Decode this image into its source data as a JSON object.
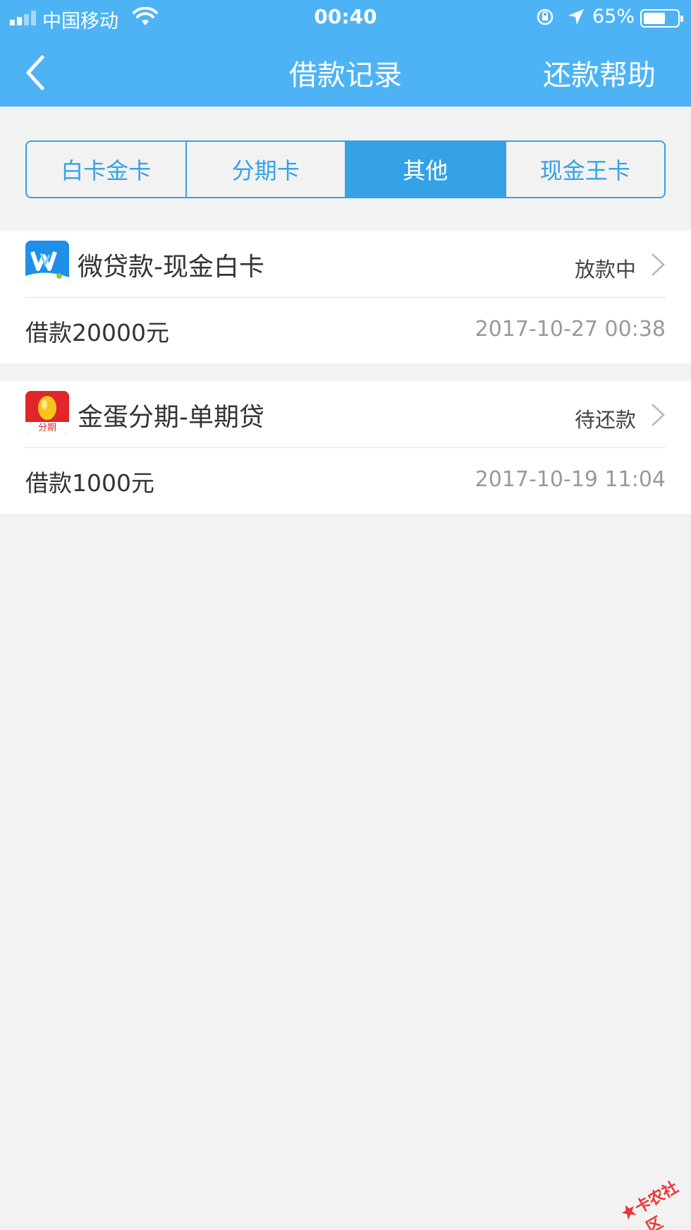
{
  "status_bar": {
    "carrier": "中国移动",
    "time": "00:40",
    "battery_percent": "65%",
    "battery_level": 0.65
  },
  "nav": {
    "title": "借款记录",
    "help": "还款帮助"
  },
  "tabs": [
    {
      "label": "白卡金卡",
      "active": false
    },
    {
      "label": "分期卡",
      "active": false
    },
    {
      "label": "其他",
      "active": true
    },
    {
      "label": "现金王卡",
      "active": false
    }
  ],
  "records": [
    {
      "name": "微贷款-现金白卡",
      "status": "放款中",
      "amount": "借款20000元",
      "date": "2017-10-27 00:38",
      "icon": "weidai-app-icon"
    },
    {
      "name": "金蛋分期-单期贷",
      "status": "待还款",
      "amount": "借款1000元",
      "date": "2017-10-19 11:04",
      "icon": "jindan-app-icon",
      "icon_text": "分期"
    }
  ],
  "watermark": "卡农社区",
  "colors": {
    "header": "#4db3f5",
    "tab_accent": "#35a2e6",
    "background": "#f2f2f2"
  }
}
